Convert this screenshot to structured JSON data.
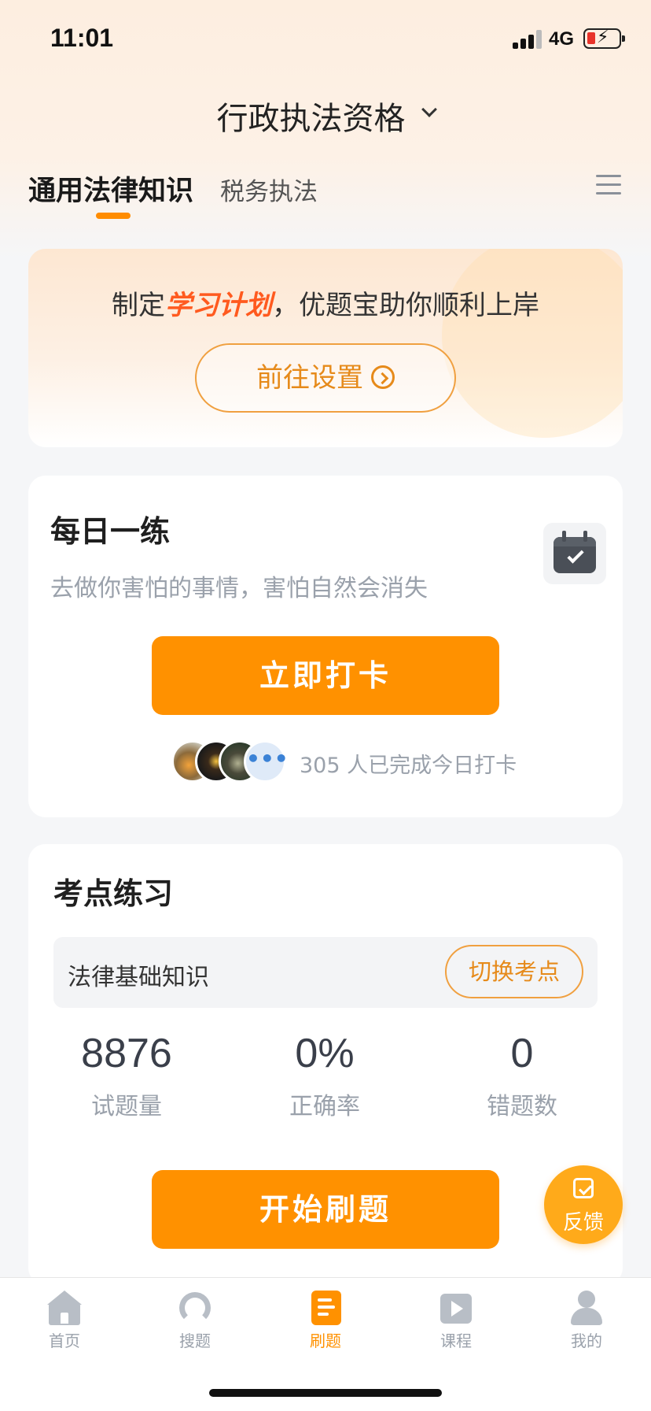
{
  "status": {
    "time": "11:01",
    "network": "4G"
  },
  "header": {
    "title": "行政执法资格"
  },
  "tabs": [
    {
      "label": "通用法律知识",
      "active": true
    },
    {
      "label": "税务执法",
      "active": false
    }
  ],
  "banner": {
    "text_before": "制定",
    "text_highlight": "学习计划",
    "text_after": "，优题宝助你顺利上岸",
    "button_label": "前往设置"
  },
  "daily": {
    "title": "每日一练",
    "subtitle": "去做你害怕的事情，害怕自然会消失",
    "button_label": "立即打卡",
    "more_icon": "•••",
    "completed_text": "305 人已完成今日打卡"
  },
  "practice": {
    "title": "考点练习",
    "topic": "法律基础知识",
    "switch_label": "切换考点",
    "stats": [
      {
        "value": "8876",
        "label": "试题量"
      },
      {
        "value": "0%",
        "label": "正确率"
      },
      {
        "value": "0",
        "label": "错题数"
      }
    ],
    "button_label": "开始刷题"
  },
  "feedback": {
    "label": "反馈"
  },
  "nav": [
    {
      "label": "首页",
      "icon": "home-icon",
      "active": false
    },
    {
      "label": "搜题",
      "icon": "search-icon",
      "active": false
    },
    {
      "label": "刷题",
      "icon": "quiz-icon",
      "active": true
    },
    {
      "label": "课程",
      "icon": "course-icon",
      "active": false
    },
    {
      "label": "我的",
      "icon": "profile-icon",
      "active": false
    }
  ],
  "colors": {
    "accent": "#ff9100",
    "highlight": "#ff5a1f",
    "muted": "#9aa1ab"
  }
}
